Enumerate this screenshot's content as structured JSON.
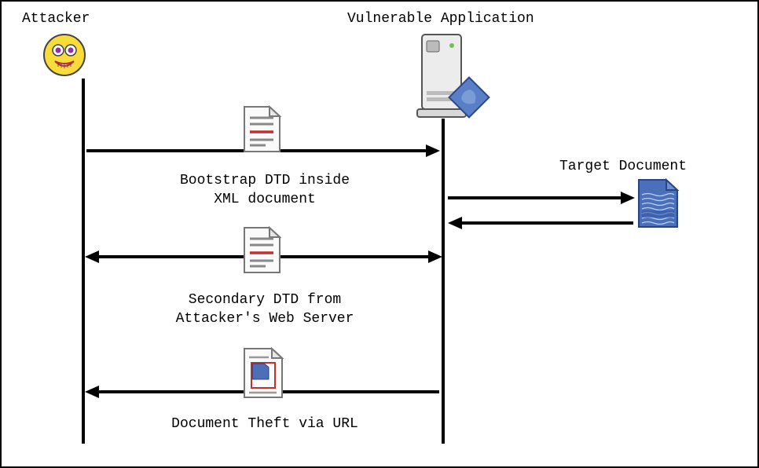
{
  "actors": {
    "attacker": "Attacker",
    "vulnerable_app": "Vulnerable Application",
    "target_doc": "Target Document"
  },
  "messages": {
    "m1": {
      "text_l1": "Bootstrap DTD inside",
      "text_l2": "XML document"
    },
    "m2": {
      "text_l1": "Secondary DTD from",
      "text_l2": "Attacker's Web Server"
    },
    "m3": {
      "text_l1": "Document Theft via URL"
    }
  },
  "icons": {
    "attacker_face": "attacker-face-icon",
    "server": "server-icon",
    "doc_dtd": "document-icon",
    "doc_target": "target-document-icon",
    "doc_theft": "document-theft-icon"
  }
}
